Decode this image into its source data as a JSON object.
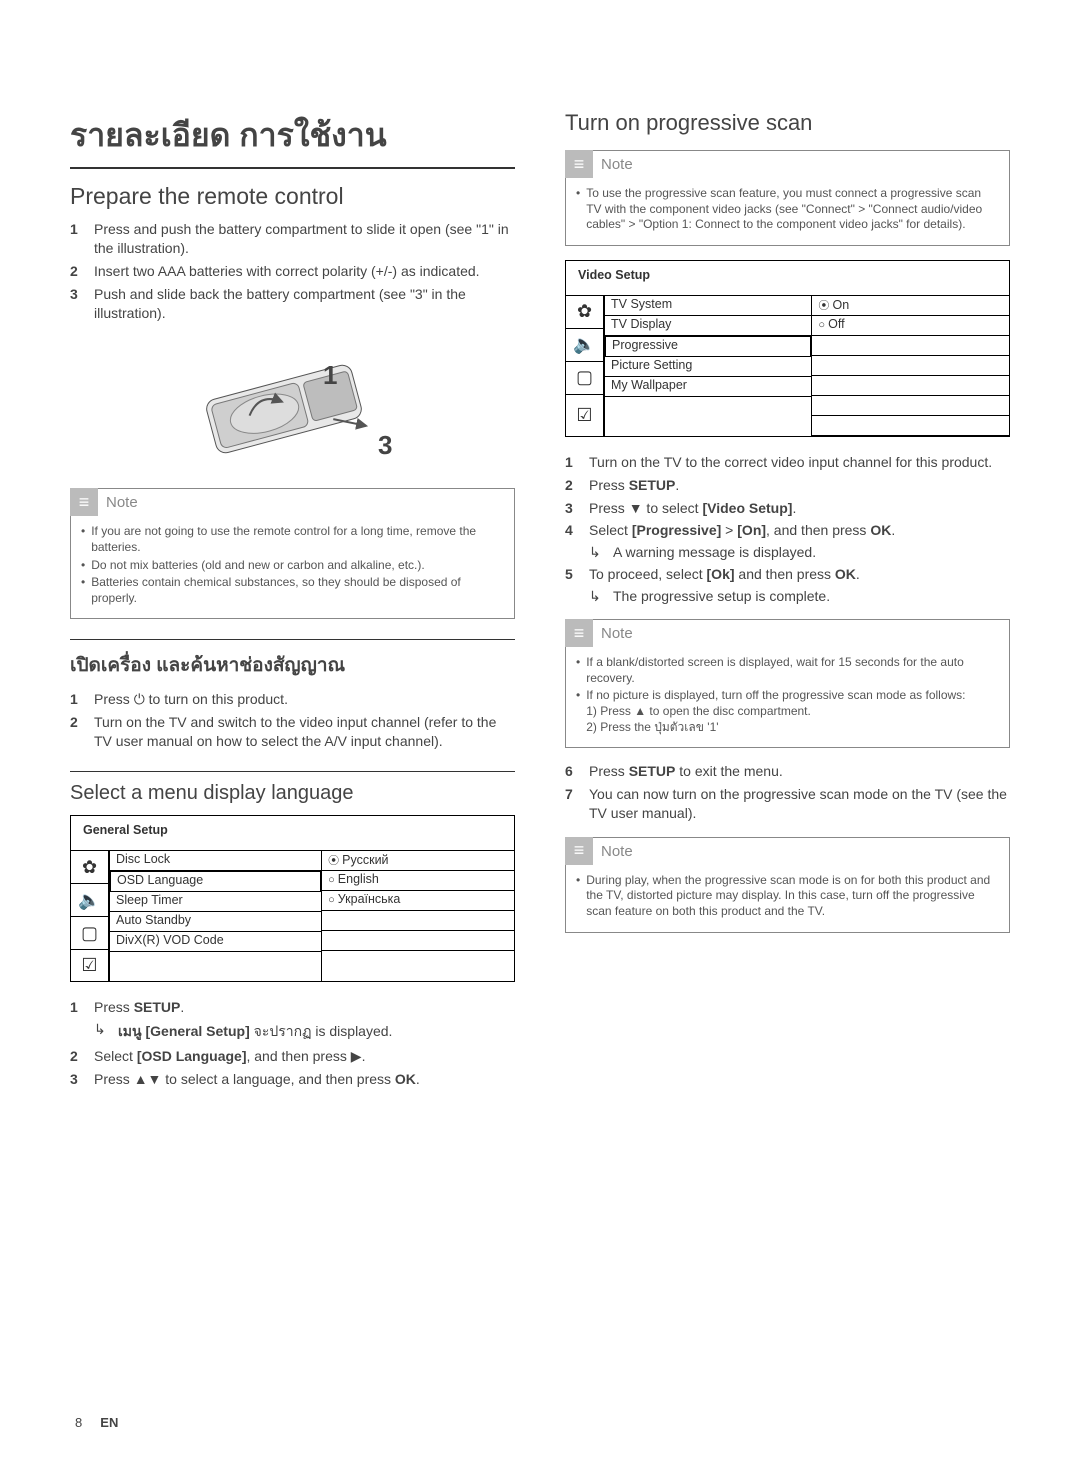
{
  "left": {
    "chapter_title": "รายละเอียด การใช้งาน",
    "section1_title": "Prepare the remote control",
    "steps1": {
      "s1": "Press and push the battery compartment to slide it open (see \"1\" in the illustration).",
      "s2": "Insert two AAA batteries with correct polarity (+/-) as indicated.",
      "s3": "Push and slide back the battery compartment (see \"3\" in the illustration)."
    },
    "illus_labels": {
      "a": "1",
      "b": "3"
    },
    "note1": {
      "title": "Note",
      "n1": "If you are not going to use the remote control for a long time, remove the batteries.",
      "n2": "Do not mix batteries (old and new or carbon and alkaline, etc.).",
      "n3": "Batteries contain chemical substances, so they should be disposed of properly."
    },
    "section2_title": "เปิดเครื่อง และค้นหาช่องสัญญาณ",
    "steps2": {
      "s1a": "Press ",
      "s1b": " to turn on this product.",
      "s2": "Turn on the TV and switch to the video input channel (refer to the TV user manual on how to select the A/V input channel)."
    },
    "section3_title": "Select a menu display language",
    "menu1": {
      "head": "General Setup",
      "items": [
        "Disc Lock",
        "OSD Language",
        "Sleep Timer",
        "Auto Standby",
        "DivX(R) VOD Code"
      ],
      "opts": [
        "Русский",
        "English",
        "Українська"
      ]
    },
    "steps3": {
      "s1a": "Press ",
      "s1b": "SETUP",
      "s1c": ".",
      "s1sub_a": "เมนู ",
      "s1sub_b": "[General Setup]",
      "s1sub_c": " จะปรากฏ is displayed.",
      "s2a": "Select ",
      "s2b": "[OSD Language]",
      "s2c": ", and then press ",
      "s2d": ".",
      "s3a": "Press ",
      "s3b": " to select a language, and then press ",
      "s3c": "OK",
      "s3d": "."
    }
  },
  "right": {
    "section1_title": "Turn on progressive scan",
    "note1": {
      "title": "Note",
      "n1": "To use the progressive scan feature, you must connect a progressive scan TV with the component video jacks (see \"Connect\" > \"Connect audio/video cables\" > \"Option 1: Connect to the component video jacks\" for details)."
    },
    "menu1": {
      "head": "Video Setup",
      "items": [
        "TV System",
        "TV Display",
        "Progressive",
        "Picture Setting",
        "My Wallpaper"
      ],
      "opts": [
        "On",
        "Off"
      ]
    },
    "steps1": {
      "s1": "Turn on the TV to the correct video input channel for this product.",
      "s2a": "Press ",
      "s2b": "SETUP",
      "s2c": ".",
      "s3a": "Press ",
      "s3b": " to select ",
      "s3c": "[Video Setup]",
      "s3d": ".",
      "s4a": "Select ",
      "s4b": "[Progressive]",
      "s4c": " > ",
      "s4d": "[On]",
      "s4e": ", and then press ",
      "s4f": "OK",
      "s4g": ".",
      "s4sub": "A warning message is displayed.",
      "s5a": "To proceed, select ",
      "s5b": "[Ok]",
      "s5c": " and then press ",
      "s5d": "OK",
      "s5e": ".",
      "s5sub": "The progressive setup is complete."
    },
    "note2": {
      "title": "Note",
      "n1": "If a blank/distorted screen is displayed, wait for 15 seconds for the auto recovery.",
      "n2a": "If no picture is displayed, turn off the progressive scan mode as follows:",
      "n2b": "1) Press ▲ to open the disc compartment.",
      "n2c": "2) Press the ปุ่มตัวเลข '1'"
    },
    "steps2": {
      "s6a": "Press ",
      "s6b": "SETUP",
      "s6c": " to exit the menu.",
      "s7": "You can now turn on the progressive scan mode on the TV (see the TV user manual)."
    },
    "note3": {
      "title": "Note",
      "n1": "During play, when the progressive scan mode is on for both this product and the TV, distorted picture may display. In this case, turn off the progressive scan feature on both this product and the TV."
    }
  },
  "footer": {
    "page": "8",
    "lang": "EN"
  },
  "icons": {
    "power": "⏻",
    "right": "▶",
    "down": "▼",
    "updown": "▲▼",
    "eject": "▲",
    "note": "≡"
  }
}
